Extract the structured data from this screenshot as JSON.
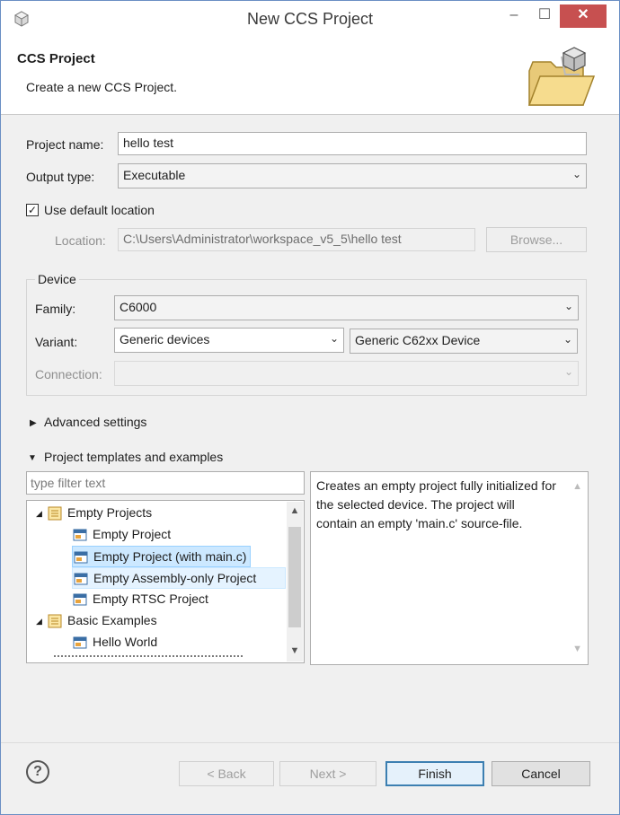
{
  "window": {
    "title": "New CCS Project"
  },
  "header": {
    "title": "CCS Project",
    "subtitle": "Create a new CCS Project."
  },
  "form": {
    "project_name_label": "Project name:",
    "project_name_value": "hello test",
    "output_type_label": "Output type:",
    "output_type_value": "Executable",
    "use_default_label": "Use default location",
    "use_default_checked": true,
    "location_label": "Location:",
    "location_value": "C:\\Users\\Administrator\\workspace_v5_5\\hello test",
    "browse_label": "Browse..."
  },
  "device": {
    "group_title": "Device",
    "family_label": "Family:",
    "family_value": "C6000",
    "variant_label": "Variant:",
    "variant_filter": "Generic devices",
    "variant_value": "Generic C62xx Device",
    "connection_label": "Connection:",
    "connection_value": ""
  },
  "sections": {
    "advanced": "Advanced settings",
    "templates": "Project templates and examples"
  },
  "templates": {
    "filter_placeholder": "type filter text",
    "items": [
      {
        "label": "Empty Projects",
        "level": 0,
        "type": "folder",
        "state": "normal"
      },
      {
        "label": "Empty Project",
        "level": 1,
        "type": "project",
        "state": "normal"
      },
      {
        "label": "Empty Project (with main.c)",
        "level": 1,
        "type": "project",
        "state": "selected"
      },
      {
        "label": "Empty Assembly-only Project",
        "level": 1,
        "type": "project",
        "state": "hover"
      },
      {
        "label": "Empty RTSC Project",
        "level": 1,
        "type": "project",
        "state": "normal"
      },
      {
        "label": "Basic Examples",
        "level": 0,
        "type": "folder",
        "state": "normal"
      },
      {
        "label": "Hello World",
        "level": 1,
        "type": "project",
        "state": "normal"
      }
    ],
    "description": "Creates an empty project fully initialized for the selected device. The project will contain an empty 'main.c' source-file."
  },
  "footer": {
    "back_label": "< Back",
    "next_label": "Next >",
    "finish_label": "Finish",
    "cancel_label": "Cancel"
  },
  "colors": {
    "selection": "#cce8ff",
    "close_button": "#c75050",
    "default_button_border": "#3c7fb1"
  }
}
